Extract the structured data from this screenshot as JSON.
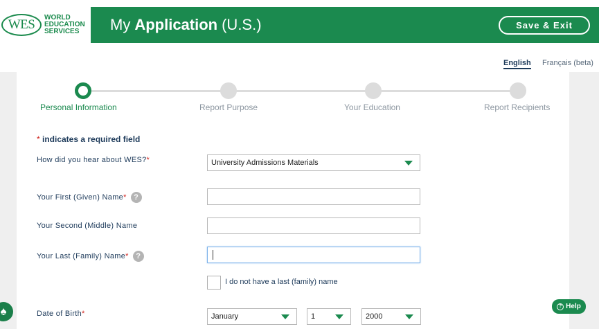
{
  "header": {
    "logo_mark": "WES",
    "logo_line1": "WORLD",
    "logo_line2": "EDUCATION",
    "logo_line3": "SERVICES",
    "title_prefix": "My",
    "title_strong": "Application",
    "title_suffix": "(U.S.)",
    "save_exit_label": "Save & Exit",
    "brand_color": "#1b8a4f"
  },
  "language": {
    "english": "English",
    "french": "Français (beta)"
  },
  "steps": [
    {
      "label": "Personal Information",
      "active": true
    },
    {
      "label": "Report Purpose",
      "active": false
    },
    {
      "label": "Your Education",
      "active": false
    },
    {
      "label": "Report Recipients",
      "active": false
    }
  ],
  "form": {
    "required_note_star": "*",
    "required_note": " indicates a required field",
    "hear_about_label": "How did you hear about WES?",
    "hear_about_value": "University Admissions Materials",
    "first_name_label": "Your First (Given) Name",
    "first_name_value": "",
    "middle_name_label": "Your Second (Middle) Name",
    "middle_name_value": "",
    "last_name_label": "Your Last (Family) Name",
    "last_name_value": "",
    "no_last_name_label": "I do not have a last (family) name",
    "dob_label": "Date of Birth",
    "dob_month": "January",
    "dob_day": "1",
    "dob_year": "2000",
    "required_star": "*",
    "help_q": "?"
  },
  "widgets": {
    "help_label": "Help",
    "help_icon_glyph": "?",
    "accessibility_icon": "accessibility-icon"
  }
}
